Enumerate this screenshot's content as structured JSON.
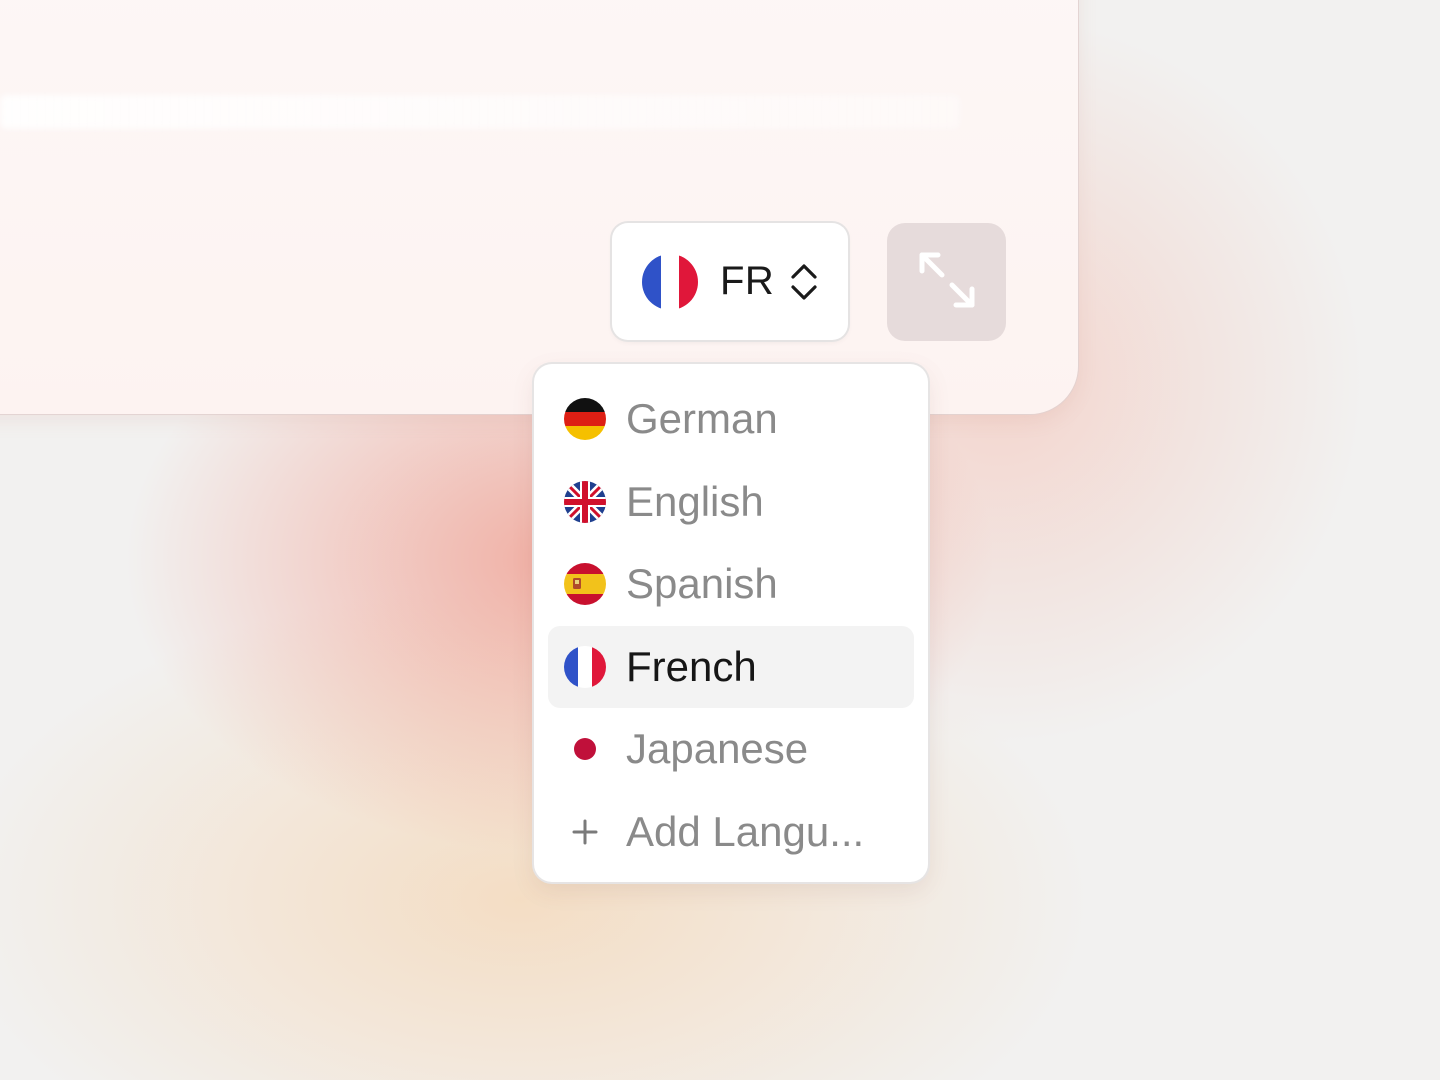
{
  "language_selector": {
    "current_code": "FR",
    "current_flag": "flag-france-icon"
  },
  "expand_button": {
    "icon": "expand-arrows-icon",
    "background": "#e6dbdb"
  },
  "dropdown": {
    "items": [
      {
        "label": "German",
        "icon": "flag-germany-icon",
        "selected": false
      },
      {
        "label": "English",
        "icon": "flag-uk-icon",
        "selected": false
      },
      {
        "label": "Spanish",
        "icon": "flag-spain-icon",
        "selected": false
      },
      {
        "label": "French",
        "icon": "flag-france-icon",
        "selected": true
      },
      {
        "label": "Japanese",
        "icon": "flag-japan-icon",
        "selected": false
      },
      {
        "label": "Add Langu...",
        "icon": "plus-icon",
        "selected": false
      }
    ]
  },
  "colors": {
    "france_blue": "#2f52c8",
    "france_red": "#e0173a",
    "germany_gold": "#f5c000",
    "germany_red": "#dd1f14",
    "spain_red": "#c8102e",
    "spain_yellow": "#f2c21b",
    "japan_red": "#c0103a",
    "selected_bg": "#f3f3f3"
  }
}
